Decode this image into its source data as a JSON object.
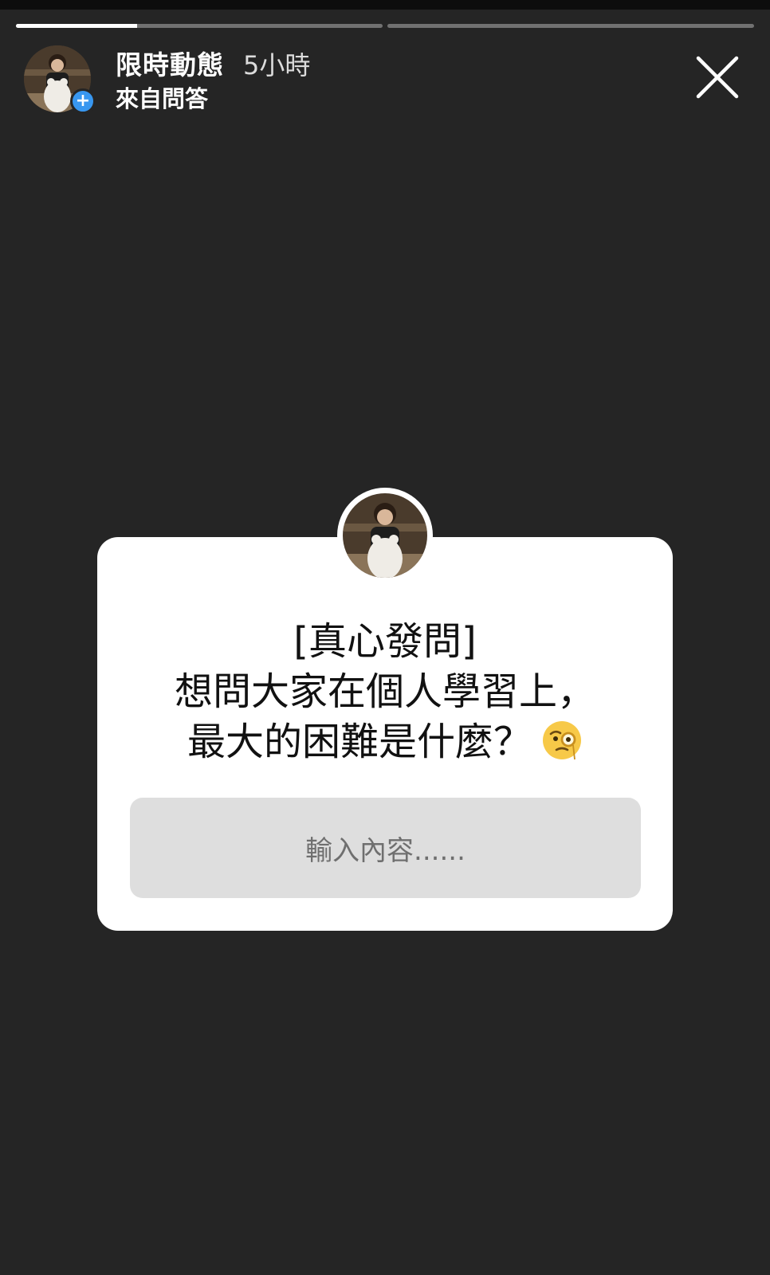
{
  "story": {
    "progress": [
      {
        "fill": 0.33
      },
      {
        "fill": 0.0
      }
    ],
    "header": {
      "title": "限時動態",
      "time": "5小時",
      "subtitle": "來自問答",
      "avatar_icon": "profile-photo",
      "badge_icon": "plus-icon",
      "close_icon": "close-icon"
    }
  },
  "question_sticker": {
    "lines": [
      "[真心發問]",
      "想問大家在個人學習上，",
      "最大的困難是什麼？"
    ],
    "emoji": "face-with-monocle",
    "input_placeholder": "輸入內容......"
  },
  "colors": {
    "background": "#252525",
    "card": "#ffffff",
    "input": "#dedede",
    "badge": "#3897f0"
  }
}
